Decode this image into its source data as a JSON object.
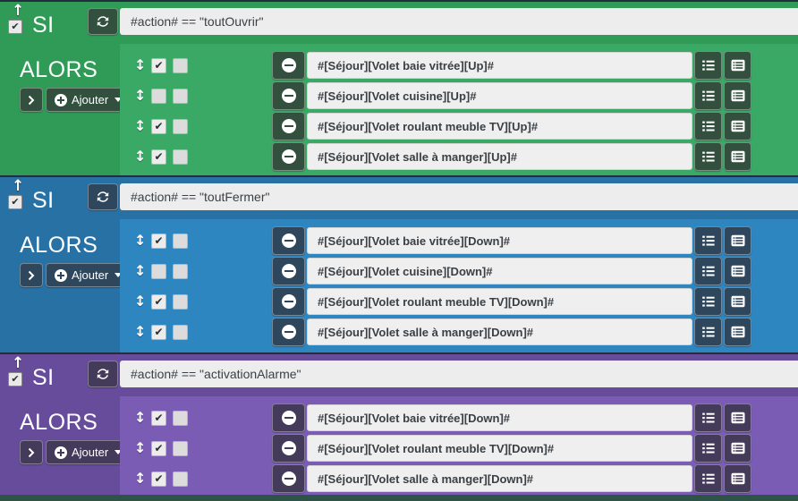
{
  "labels": {
    "si": "SI",
    "alors": "ALORS",
    "ajouter": "Ajouter"
  },
  "icons": {
    "refresh": "refresh-icon",
    "arrows_v": "↕",
    "drag_arrow": "↑",
    "check": "✔",
    "caret_down": "caret-down-icon",
    "chevron_right": "chevron-right-icon",
    "minus_circle": "minus-circle-icon",
    "plus_circle": "plus-circle-icon",
    "list_ul": "list-ul-icon",
    "list_alt": "list-alt-icon"
  },
  "colors": {
    "separator": "#232d3c",
    "bottom_strip": "#2e5447",
    "input_bg": "#ededed",
    "input_text": "#3b4045"
  },
  "blocks": [
    {
      "condition": "#action# == \"toutOuvrir\"",
      "theme": {
        "outer": "#2f9b57",
        "inner": "#3aa966",
        "button": "#33503e"
      },
      "actions": [
        {
          "checked": true,
          "checked2": false,
          "value": "#[Séjour][Volet baie vitrée][Up]#"
        },
        {
          "checked": false,
          "checked2": false,
          "value": "#[Séjour][Volet cuisine][Up]#"
        },
        {
          "checked": true,
          "checked2": false,
          "value": "#[Séjour][Volet roulant meuble TV][Up]#"
        },
        {
          "checked": true,
          "checked2": false,
          "value": "#[Séjour][Volet salle à manger][Up]#"
        }
      ]
    },
    {
      "condition": "#action# == \"toutFermer\"",
      "theme": {
        "outer": "#2871a4",
        "inner": "#2e86c1",
        "button": "#2f475c"
      },
      "actions": [
        {
          "checked": true,
          "checked2": false,
          "value": "#[Séjour][Volet baie vitrée][Down]#"
        },
        {
          "checked": false,
          "checked2": false,
          "value": "#[Séjour][Volet cuisine][Down]#"
        },
        {
          "checked": true,
          "checked2": false,
          "value": "#[Séjour][Volet roulant meuble TV][Down]#"
        },
        {
          "checked": true,
          "checked2": false,
          "value": "#[Séjour][Volet salle à manger][Down]#"
        }
      ]
    },
    {
      "condition": "#action# == \"activationAlarme\"",
      "theme": {
        "outer": "#664c9b",
        "inner": "#7a5cb5",
        "button": "#443a59"
      },
      "actions": [
        {
          "checked": true,
          "checked2": false,
          "value": "#[Séjour][Volet baie vitrée][Down]#"
        },
        {
          "checked": true,
          "checked2": false,
          "value": "#[Séjour][Volet roulant meuble TV][Down]#"
        },
        {
          "checked": true,
          "checked2": false,
          "value": "#[Séjour][Volet salle à manger][Down]#"
        }
      ]
    }
  ]
}
